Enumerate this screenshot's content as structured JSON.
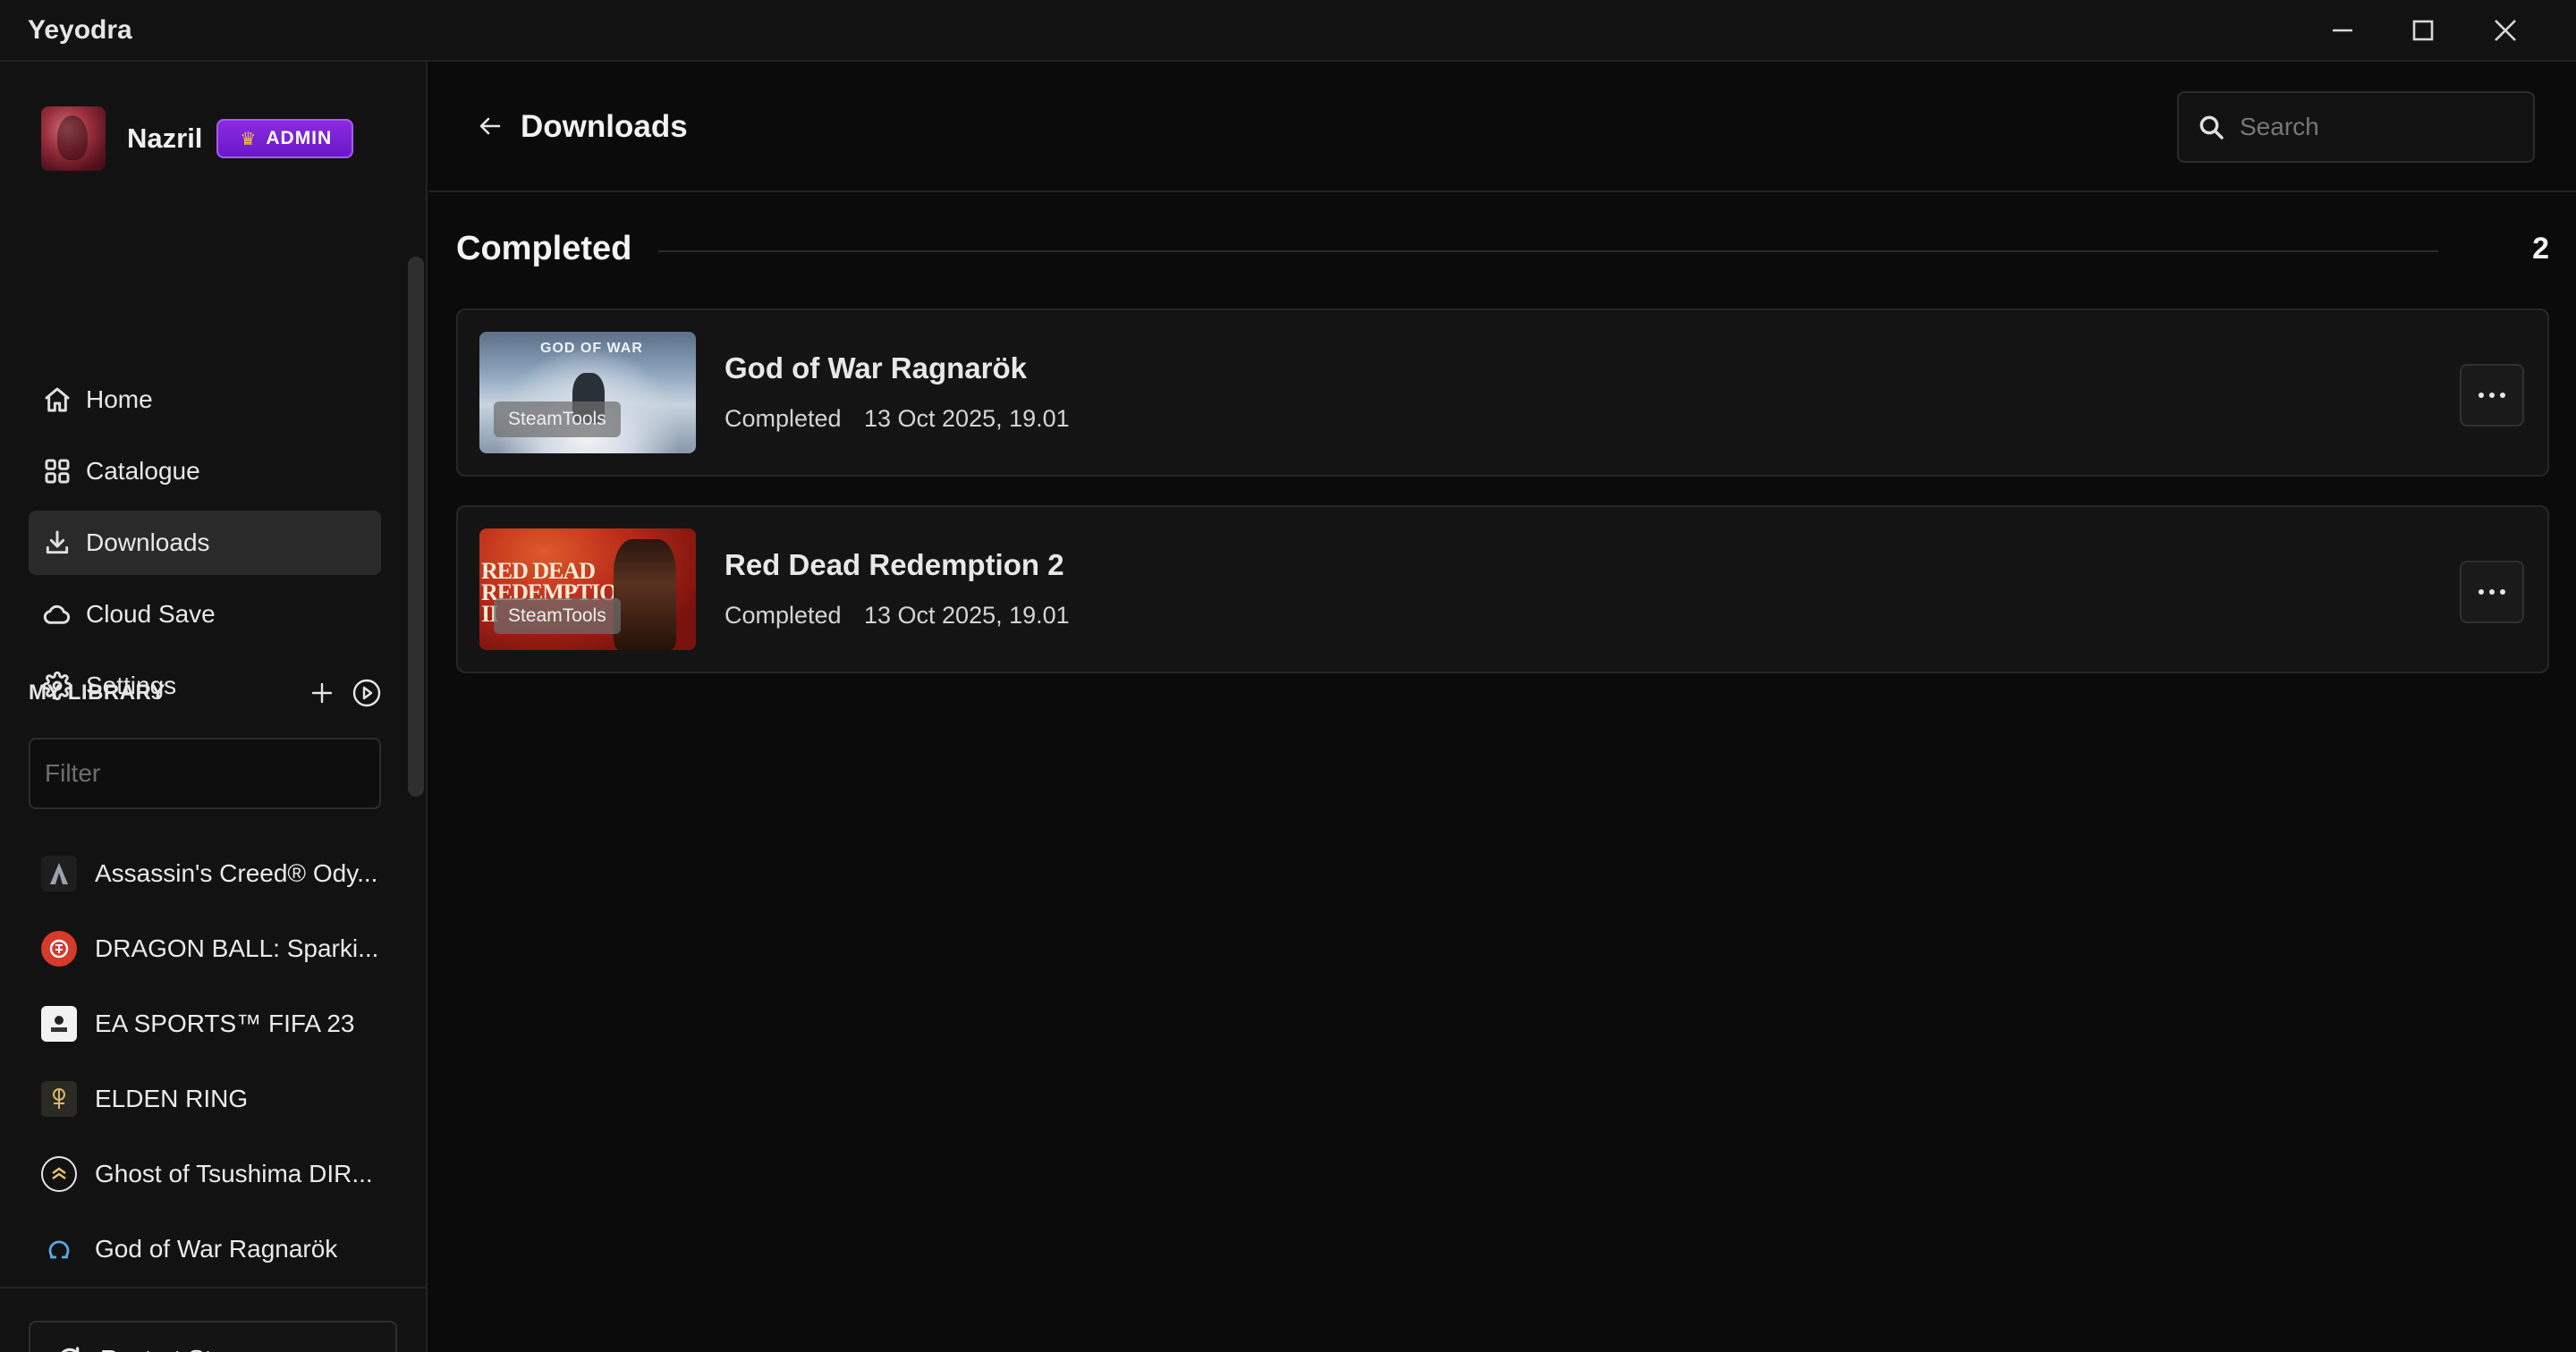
{
  "app": {
    "title": "Yeyodra"
  },
  "profile": {
    "username": "Nazril",
    "badge": "ADMIN"
  },
  "nav": [
    {
      "label": "Home",
      "icon": "home-icon"
    },
    {
      "label": "Catalogue",
      "icon": "grid-icon"
    },
    {
      "label": "Downloads",
      "icon": "download-icon",
      "active": true
    },
    {
      "label": "Cloud Save",
      "icon": "cloud-icon"
    },
    {
      "label": "Settings",
      "icon": "gear-icon"
    }
  ],
  "library": {
    "title": "MY LIBRARY",
    "filter_placeholder": "Filter",
    "games": [
      {
        "label": "Assassin's Creed® Ody...",
        "icon": "assassins-creed-icon"
      },
      {
        "label": "DRAGON BALL: Sparki...",
        "icon": "dragon-ball-icon"
      },
      {
        "label": "EA SPORTS™ FIFA 23",
        "icon": "fifa-icon"
      },
      {
        "label": "ELDEN RING",
        "icon": "elden-ring-icon"
      },
      {
        "label": "Ghost of Tsushima DIR...",
        "icon": "ghost-of-tsushima-icon"
      },
      {
        "label": "God of War Ragnarök",
        "icon": "god-of-war-icon"
      }
    ]
  },
  "footer": {
    "restart_label": "Restart Steam"
  },
  "main": {
    "title": "Downloads",
    "search_placeholder": "Search",
    "section": {
      "title": "Completed",
      "count": "2"
    },
    "downloads": [
      {
        "name": "God of War Ragnarök",
        "status": "Completed",
        "date": "13 Oct 2025, 19.01",
        "source": "SteamTools",
        "thumb_text": "GOD OF WAR"
      },
      {
        "name": "Red Dead Redemption 2",
        "status": "Completed",
        "date": "13 Oct 2025, 19.01",
        "source": "SteamTools",
        "thumb_text": "RED DEAD REDEMPTION II"
      }
    ]
  },
  "colors": {
    "accent_admin": "#7a22d6",
    "background": "#0b0b0b",
    "sidebar": "#121212",
    "crown": "#f5c542"
  }
}
